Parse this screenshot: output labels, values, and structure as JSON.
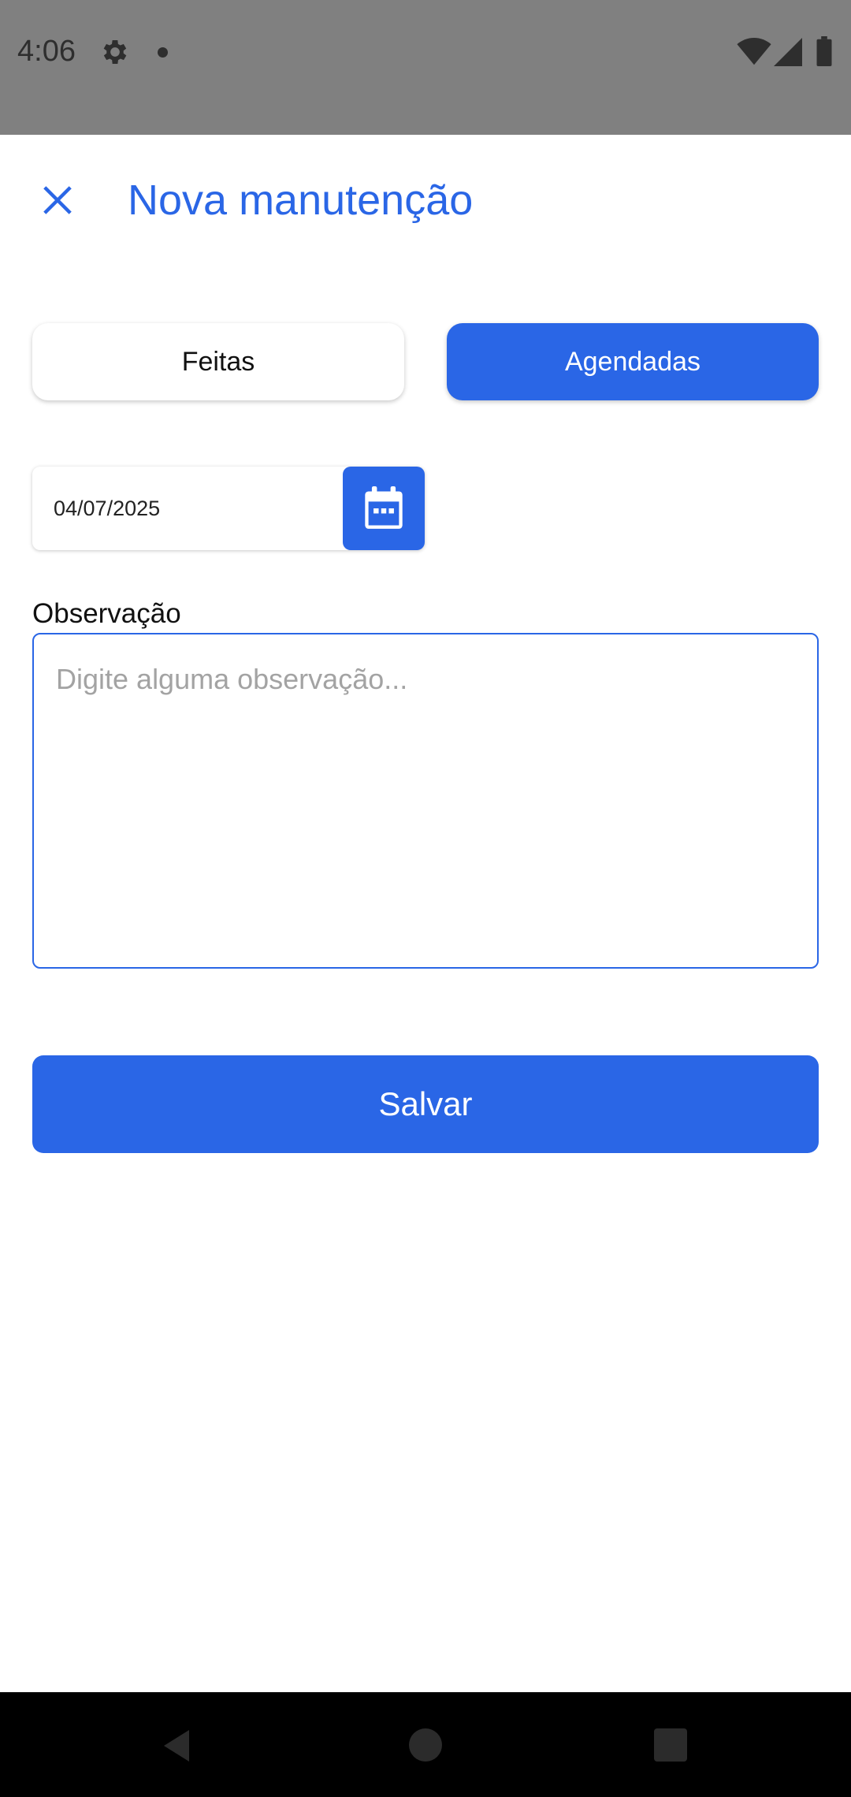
{
  "status_bar": {
    "time": "4:06",
    "icons": [
      "gear-icon",
      "notification-dot",
      "wifi-icon",
      "signal-icon",
      "battery-icon"
    ]
  },
  "header": {
    "title": "Nova manutenção",
    "close_icon": "close-icon"
  },
  "segments": {
    "done_label": "Feitas",
    "scheduled_label": "Agendadas",
    "selected": "Agendadas"
  },
  "date": {
    "value": "04/07/2025",
    "calendar_icon": "calendar-icon"
  },
  "observation": {
    "label": "Observação",
    "placeholder": "Digite alguma observação...",
    "value": ""
  },
  "actions": {
    "save_label": "Salvar"
  },
  "colors": {
    "accent": "#2a66e6",
    "status_bar": "#808080",
    "nav_bar": "#000000"
  }
}
